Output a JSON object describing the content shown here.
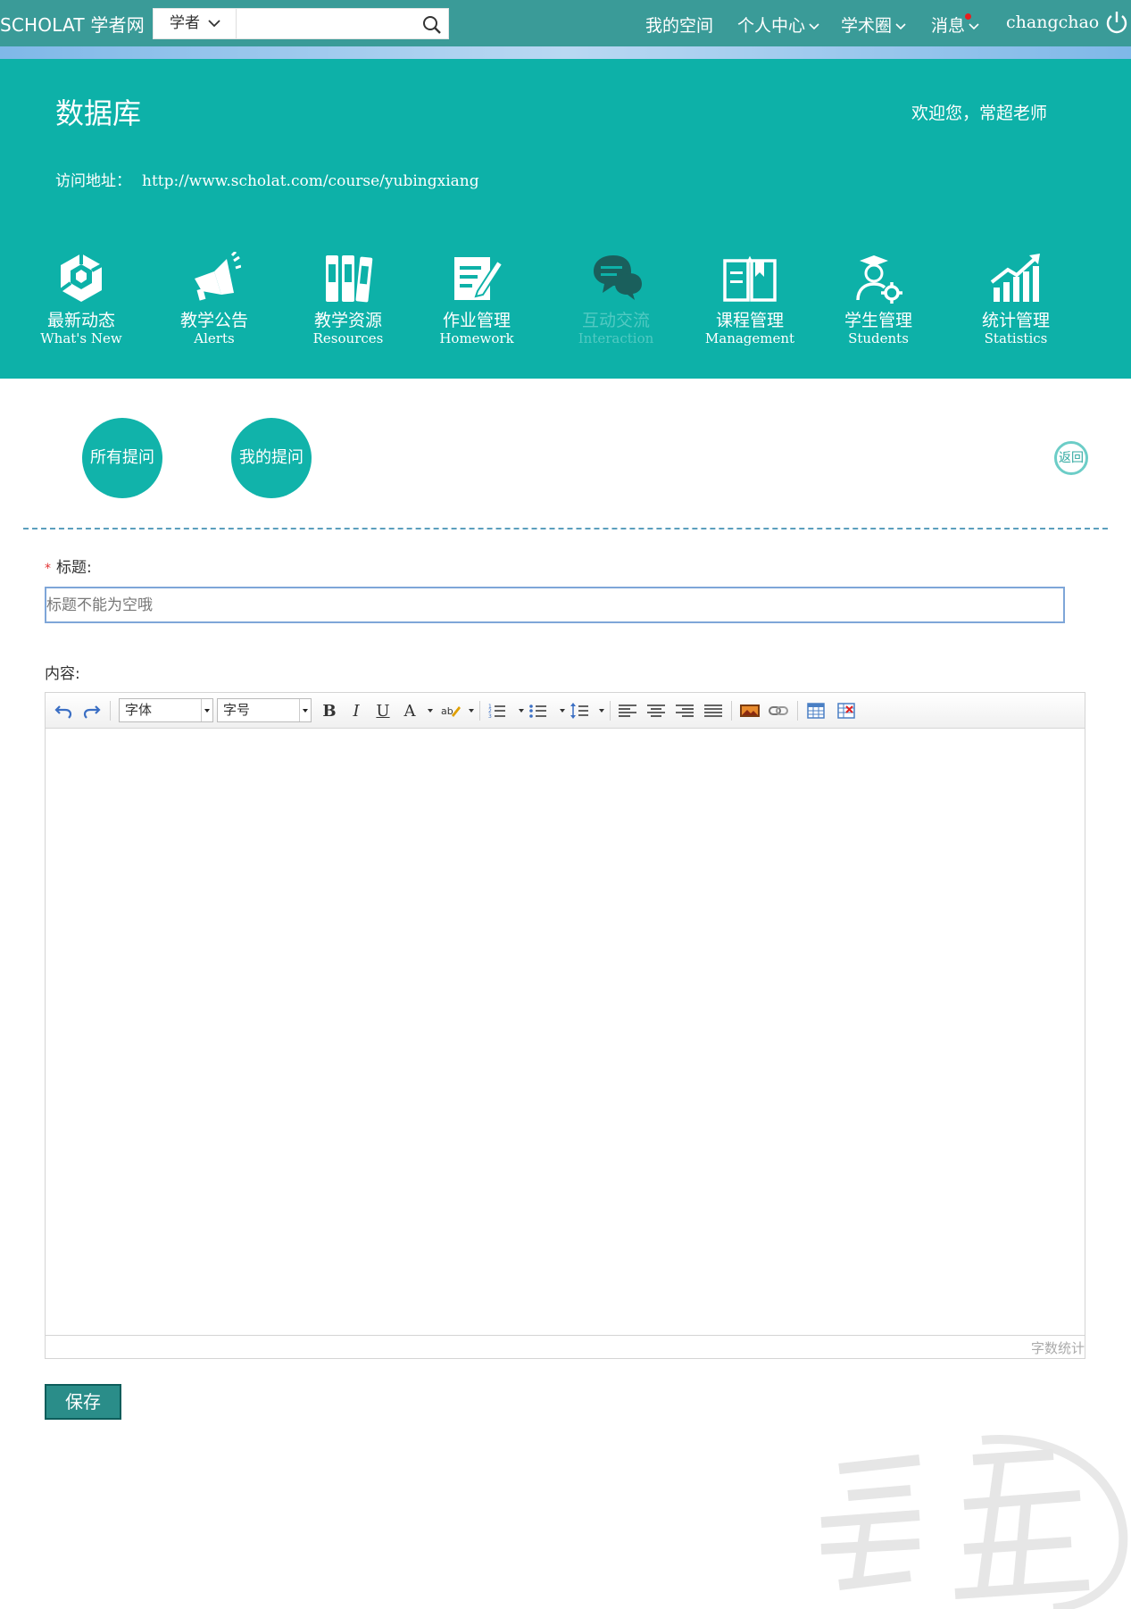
{
  "topbar": {
    "logo": "SCHOLAT 学者网",
    "search_type": "学者",
    "search_value": "",
    "nav": [
      "我的空间",
      "个人中心",
      "学术圈",
      "消息"
    ],
    "username": "changchao",
    "has_new_message": true
  },
  "hero": {
    "title": "数据库",
    "welcome": "欢迎您，常超老师",
    "address_label": "访问地址：",
    "address_url": "http://www.scholat.com/course/yubingxiang"
  },
  "modules": [
    {
      "cn": "最新动态",
      "en": "What's New",
      "icon": "news-cube-icon"
    },
    {
      "cn": "教学公告",
      "en": "Alerts",
      "icon": "megaphone-icon"
    },
    {
      "cn": "教学资源",
      "en": "Resources",
      "icon": "binders-icon"
    },
    {
      "cn": "作业管理",
      "en": "Homework",
      "icon": "pen-document-icon"
    },
    {
      "cn": "互动交流",
      "en": "Interaction",
      "icon": "chat-bubbles-icon",
      "active": true
    },
    {
      "cn": "课程管理",
      "en": "Management",
      "icon": "open-book-icon"
    },
    {
      "cn": "学生管理",
      "en": "Students",
      "icon": "student-gear-icon"
    },
    {
      "cn": "统计管理",
      "en": "Statistics",
      "icon": "rising-bars-icon"
    }
  ],
  "question_tabs": {
    "all": "所有提问",
    "mine": "我的提问",
    "back": "返回"
  },
  "form": {
    "title_label": "标题:",
    "title_placeholder": "标题不能为空哦",
    "title_value": "",
    "content_label": "内容:",
    "font_select": "字体",
    "size_select": "字号",
    "word_count": "字数统计",
    "save_label": "保存"
  },
  "colors": {
    "topbar": "#3a9b98",
    "hero": "#0db1a8",
    "circle_button": "#11b3aa",
    "save_button": "#2a8d89",
    "divider": "#5b9fbd"
  }
}
